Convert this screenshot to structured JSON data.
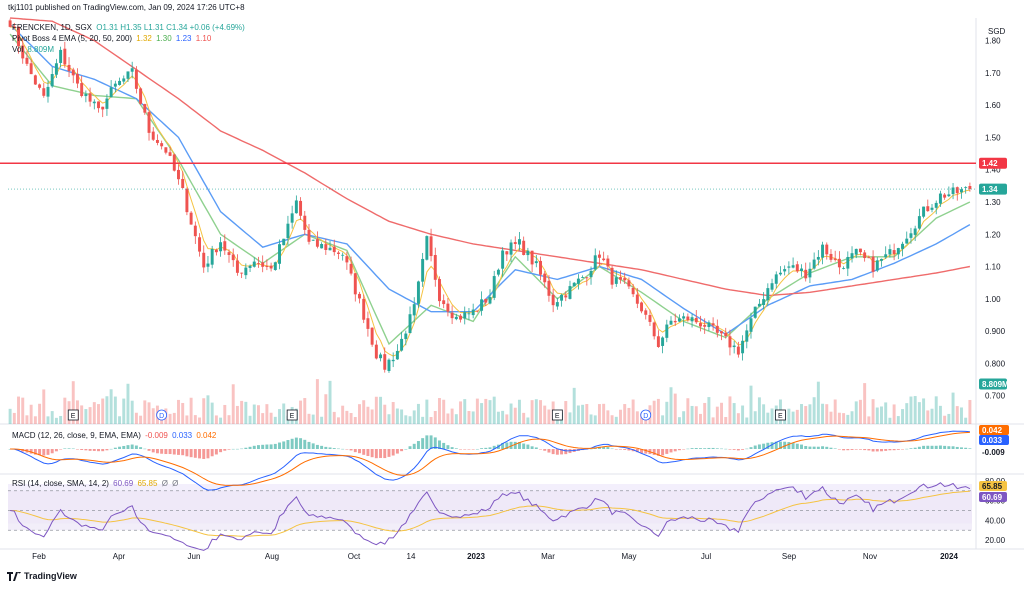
{
  "publish_line": "tkj1101 published on TradingView.com, Jan 09, 2024 17:26 UTC+8",
  "brand": "TradingView",
  "currency": "SGD",
  "header": {
    "symbol": "FRENCKEN, 1D, SGX",
    "ohlc": "O1.31  H1.35  L1.31  C1.34  +0.06 (+4.69%)",
    "ema_label": "Pivot Boss 4 EMA (5, 20, 50, 200)",
    "ema_values": [
      "1.32",
      "1.30",
      "1.23",
      "1.10"
    ],
    "vol_label": "Vol",
    "vol_value": "8.809M"
  },
  "macd": {
    "label": "MACD (12, 26, close, 9, EMA, EMA)",
    "values": [
      "-0.009",
      "0.033",
      "0.042"
    ]
  },
  "rsi": {
    "label": "RSI (14, close, SMA, 14, 2)",
    "values": [
      "60.69",
      "65.85",
      "Ø",
      "Ø"
    ]
  },
  "colors": {
    "up": "#26a69a",
    "down": "#ef5350",
    "ema5": "#f5c342",
    "ema20": "#8fd18f",
    "ema50": "#5b9cf6",
    "ema200": "#ef6b6b",
    "resistance": "#f23645",
    "macd": "#2962ff",
    "signal": "#ff6d00",
    "rsi": "#7e57c2"
  },
  "chart_data": [
    {
      "type": "candlestick",
      "title": "FRENCKEN, 1D, SGX",
      "x_ticks": [
        "Feb",
        "Apr",
        "Jun",
        "Aug",
        "Oct",
        "14",
        "2023",
        "Mar",
        "May",
        "Jul",
        "Sep",
        "Nov",
        "2024"
      ],
      "y_ticks": [
        "1.80",
        "1.70",
        "1.60",
        "1.50",
        "1.40",
        "1.30",
        "1.20",
        "1.10",
        "1.00",
        "0.900",
        "0.800",
        "0.700"
      ],
      "ylim": [
        0.64,
        1.87
      ],
      "close_path": [
        [
          0,
          1.86
        ],
        [
          4,
          1.72
        ],
        [
          8,
          1.62
        ],
        [
          12,
          1.76
        ],
        [
          16,
          1.66
        ],
        [
          21,
          1.58
        ],
        [
          25,
          1.66
        ],
        [
          29,
          1.7
        ],
        [
          33,
          1.52
        ],
        [
          37,
          1.46
        ],
        [
          41,
          1.33
        ],
        [
          46,
          1.1
        ],
        [
          50,
          1.18
        ],
        [
          54,
          1.08
        ],
        [
          58,
          1.12
        ],
        [
          62,
          1.09
        ],
        [
          66,
          1.22
        ],
        [
          68,
          1.3
        ],
        [
          71,
          1.17
        ],
        [
          75,
          1.16
        ],
        [
          79,
          1.14
        ],
        [
          83,
          0.99
        ],
        [
          87,
          0.83
        ],
        [
          89,
          0.79
        ],
        [
          92,
          0.84
        ],
        [
          96,
          0.97
        ],
        [
          99,
          1.18
        ],
        [
          102,
          1.01
        ],
        [
          106,
          0.94
        ],
        [
          110,
          0.96
        ],
        [
          114,
          1.01
        ],
        [
          117,
          1.15
        ],
        [
          121,
          1.17
        ],
        [
          125,
          1.1
        ],
        [
          129,
          0.99
        ],
        [
          133,
          1.03
        ],
        [
          137,
          1.08
        ],
        [
          140,
          1.14
        ],
        [
          143,
          1.06
        ],
        [
          146,
          1.04
        ],
        [
          150,
          0.97
        ],
        [
          154,
          0.86
        ],
        [
          157,
          0.93
        ],
        [
          161,
          0.94
        ],
        [
          165,
          0.92
        ],
        [
          169,
          0.88
        ],
        [
          173,
          0.84
        ],
        [
          177,
          0.96
        ],
        [
          181,
          1.06
        ],
        [
          185,
          1.1
        ],
        [
          189,
          1.08
        ],
        [
          193,
          1.16
        ],
        [
          197,
          1.1
        ],
        [
          201,
          1.14
        ],
        [
          205,
          1.1
        ],
        [
          209,
          1.14
        ],
        [
          213,
          1.2
        ],
        [
          217,
          1.27
        ],
        [
          221,
          1.32
        ],
        [
          225,
          1.33
        ],
        [
          228,
          1.34
        ]
      ],
      "resistance_level": 1.42,
      "resistance_label": "1.42",
      "last_price_label": "1.34",
      "ema_series": [
        {
          "name": "EMA 20",
          "points": [
            [
              0,
              1.82
            ],
            [
              10,
              1.66
            ],
            [
              20,
              1.63
            ],
            [
              30,
              1.62
            ],
            [
              40,
              1.43
            ],
            [
              50,
              1.2
            ],
            [
              60,
              1.11
            ],
            [
              70,
              1.2
            ],
            [
              80,
              1.15
            ],
            [
              90,
              0.86
            ],
            [
              100,
              0.98
            ],
            [
              110,
              0.93
            ],
            [
              120,
              1.13
            ],
            [
              130,
              1.0
            ],
            [
              140,
              1.1
            ],
            [
              150,
              1.02
            ],
            [
              160,
              0.93
            ],
            [
              170,
              0.88
            ],
            [
              180,
              1.0
            ],
            [
              190,
              1.08
            ],
            [
              200,
              1.13
            ],
            [
              210,
              1.13
            ],
            [
              220,
              1.25
            ],
            [
              228,
              1.3
            ]
          ]
        },
        {
          "name": "EMA 50",
          "points": [
            [
              0,
              1.85
            ],
            [
              10,
              1.72
            ],
            [
              20,
              1.68
            ],
            [
              30,
              1.62
            ],
            [
              40,
              1.5
            ],
            [
              50,
              1.27
            ],
            [
              60,
              1.16
            ],
            [
              70,
              1.2
            ],
            [
              80,
              1.17
            ],
            [
              90,
              1.03
            ],
            [
              100,
              0.96
            ],
            [
              110,
              0.96
            ],
            [
              120,
              1.09
            ],
            [
              130,
              1.06
            ],
            [
              140,
              1.1
            ],
            [
              150,
              1.06
            ],
            [
              160,
              0.97
            ],
            [
              170,
              0.89
            ],
            [
              180,
              0.98
            ],
            [
              190,
              1.04
            ],
            [
              200,
              1.06
            ],
            [
              210,
              1.11
            ],
            [
              220,
              1.17
            ],
            [
              228,
              1.23
            ]
          ]
        },
        {
          "name": "EMA 200",
          "points": [
            [
              0,
              1.87
            ],
            [
              10,
              1.86
            ],
            [
              20,
              1.8
            ],
            [
              30,
              1.71
            ],
            [
              40,
              1.62
            ],
            [
              50,
              1.52
            ],
            [
              60,
              1.46
            ],
            [
              70,
              1.39
            ],
            [
              80,
              1.31
            ],
            [
              90,
              1.24
            ],
            [
              100,
              1.2
            ],
            [
              110,
              1.17
            ],
            [
              120,
              1.15
            ],
            [
              130,
              1.13
            ],
            [
              140,
              1.11
            ],
            [
              150,
              1.09
            ],
            [
              160,
              1.06
            ],
            [
              170,
              1.03
            ],
            [
              180,
              1.01
            ],
            [
              190,
              1.02
            ],
            [
              200,
              1.04
            ],
            [
              210,
              1.06
            ],
            [
              220,
              1.08
            ],
            [
              228,
              1.1
            ]
          ]
        }
      ]
    },
    {
      "type": "bar",
      "title": "Vol",
      "value_label": "8.809M",
      "earnings_markers": [
        [
          "E",
          15
        ],
        [
          "D",
          36
        ],
        [
          "E",
          67
        ],
        [
          "E",
          130
        ],
        [
          "D",
          151
        ],
        [
          "E",
          183
        ]
      ]
    },
    {
      "type": "line",
      "title": "MACD (12, 26, close, 9, EMA, EMA)",
      "value_labels": [
        "0.042",
        "0.033",
        "-0.009"
      ]
    },
    {
      "type": "line",
      "title": "RSI (14, close, SMA, 14, 2)",
      "y_ticks": [
        "80.00",
        "60.00",
        "40.00",
        "20.00"
      ],
      "ylim": [
        15,
        85
      ],
      "value_labels": [
        "65.85",
        "60.69"
      ],
      "band": [
        30,
        70
      ],
      "midline": 50
    }
  ]
}
